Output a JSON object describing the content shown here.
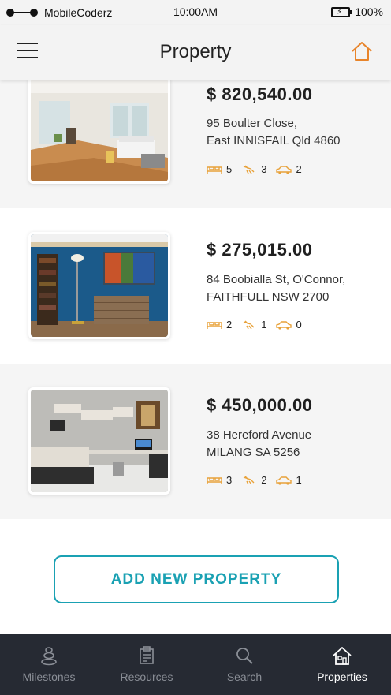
{
  "status_bar": {
    "carrier": "MobileCoderz",
    "time": "10:00AM",
    "battery": "100%"
  },
  "header": {
    "title": "Property",
    "menu_icon": "hamburger-menu-icon",
    "home_icon": "home-icon",
    "accent_color": "#e8842a"
  },
  "properties": [
    {
      "price": "$ 820,540.00",
      "address_line1": "95 Boulter Close,",
      "address_line2": "East INNISFAIL Qld 4860",
      "beds": "5",
      "baths": "3",
      "cars": "2"
    },
    {
      "price": "$ 275,015.00",
      "address_line1": "84 Boobialla St, O'Connor,",
      "address_line2": "FAITHFULL NSW 2700",
      "beds": "2",
      "baths": "1",
      "cars": "0"
    },
    {
      "price": "$ 450,000.00",
      "address_line1": "38 Hereford Avenue",
      "address_line2": "MILANG SA 5256",
      "beds": "3",
      "baths": "2",
      "cars": "1"
    }
  ],
  "add_button": {
    "label": "ADD NEW PROPERTY",
    "color": "#1aa1b3"
  },
  "bottom_nav": {
    "items": [
      {
        "label": "Milestones",
        "icon": "stacked-stones-icon"
      },
      {
        "label": "Resources",
        "icon": "clipboard-icon"
      },
      {
        "label": "Search",
        "icon": "search-icon"
      },
      {
        "label": "Properties",
        "icon": "house-icon",
        "active": true
      }
    ],
    "background": "#262a33"
  }
}
